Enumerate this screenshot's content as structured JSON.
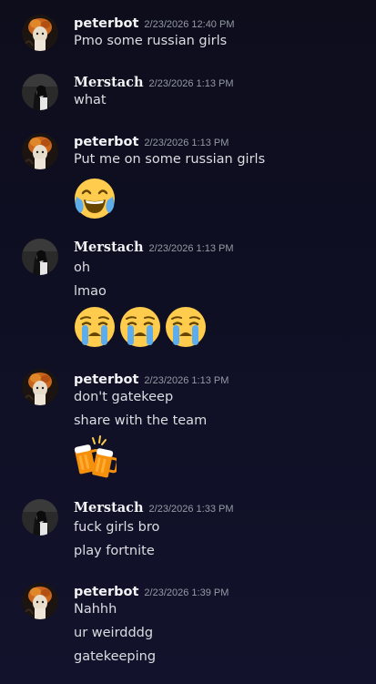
{
  "messages": [
    {
      "username": "peterbot",
      "timestamp": "2/23/2026 12:40 PM",
      "lines": [
        "Pmo some russian girls"
      ]
    },
    {
      "username": "Merstach",
      "timestamp": "2/23/2026 1:13 PM",
      "lines": [
        "what"
      ]
    },
    {
      "username": "peterbot",
      "timestamp": "2/23/2026 1:13 PM",
      "lines": [
        "Put me on some russian girls"
      ],
      "emoji": [
        "joy-emoji"
      ]
    },
    {
      "username": "Merstach",
      "timestamp": "2/23/2026 1:13 PM",
      "lines": [
        "oh",
        "lmao"
      ],
      "emoji": [
        "sob-emoji",
        "sob-emoji",
        "sob-emoji"
      ]
    },
    {
      "username": "peterbot",
      "timestamp": "2/23/2026 1:13 PM",
      "lines": [
        "don't gatekeep",
        "share with the team"
      ],
      "emoji": [
        "beers-emoji"
      ]
    },
    {
      "username": "Merstach",
      "timestamp": "2/23/2026 1:33 PM",
      "lines": [
        "fuck girls bro",
        "play fortnite"
      ]
    },
    {
      "username": "peterbot",
      "timestamp": "2/23/2026 1:39 PM",
      "lines": [
        "Nahhh",
        "ur weirdddg",
        "gatekeeping"
      ]
    }
  ],
  "colors": {
    "background": "#0e0e20",
    "username": "#f2f3f5",
    "message_text": "#dbdee1",
    "timestamp": "#949ba4"
  }
}
